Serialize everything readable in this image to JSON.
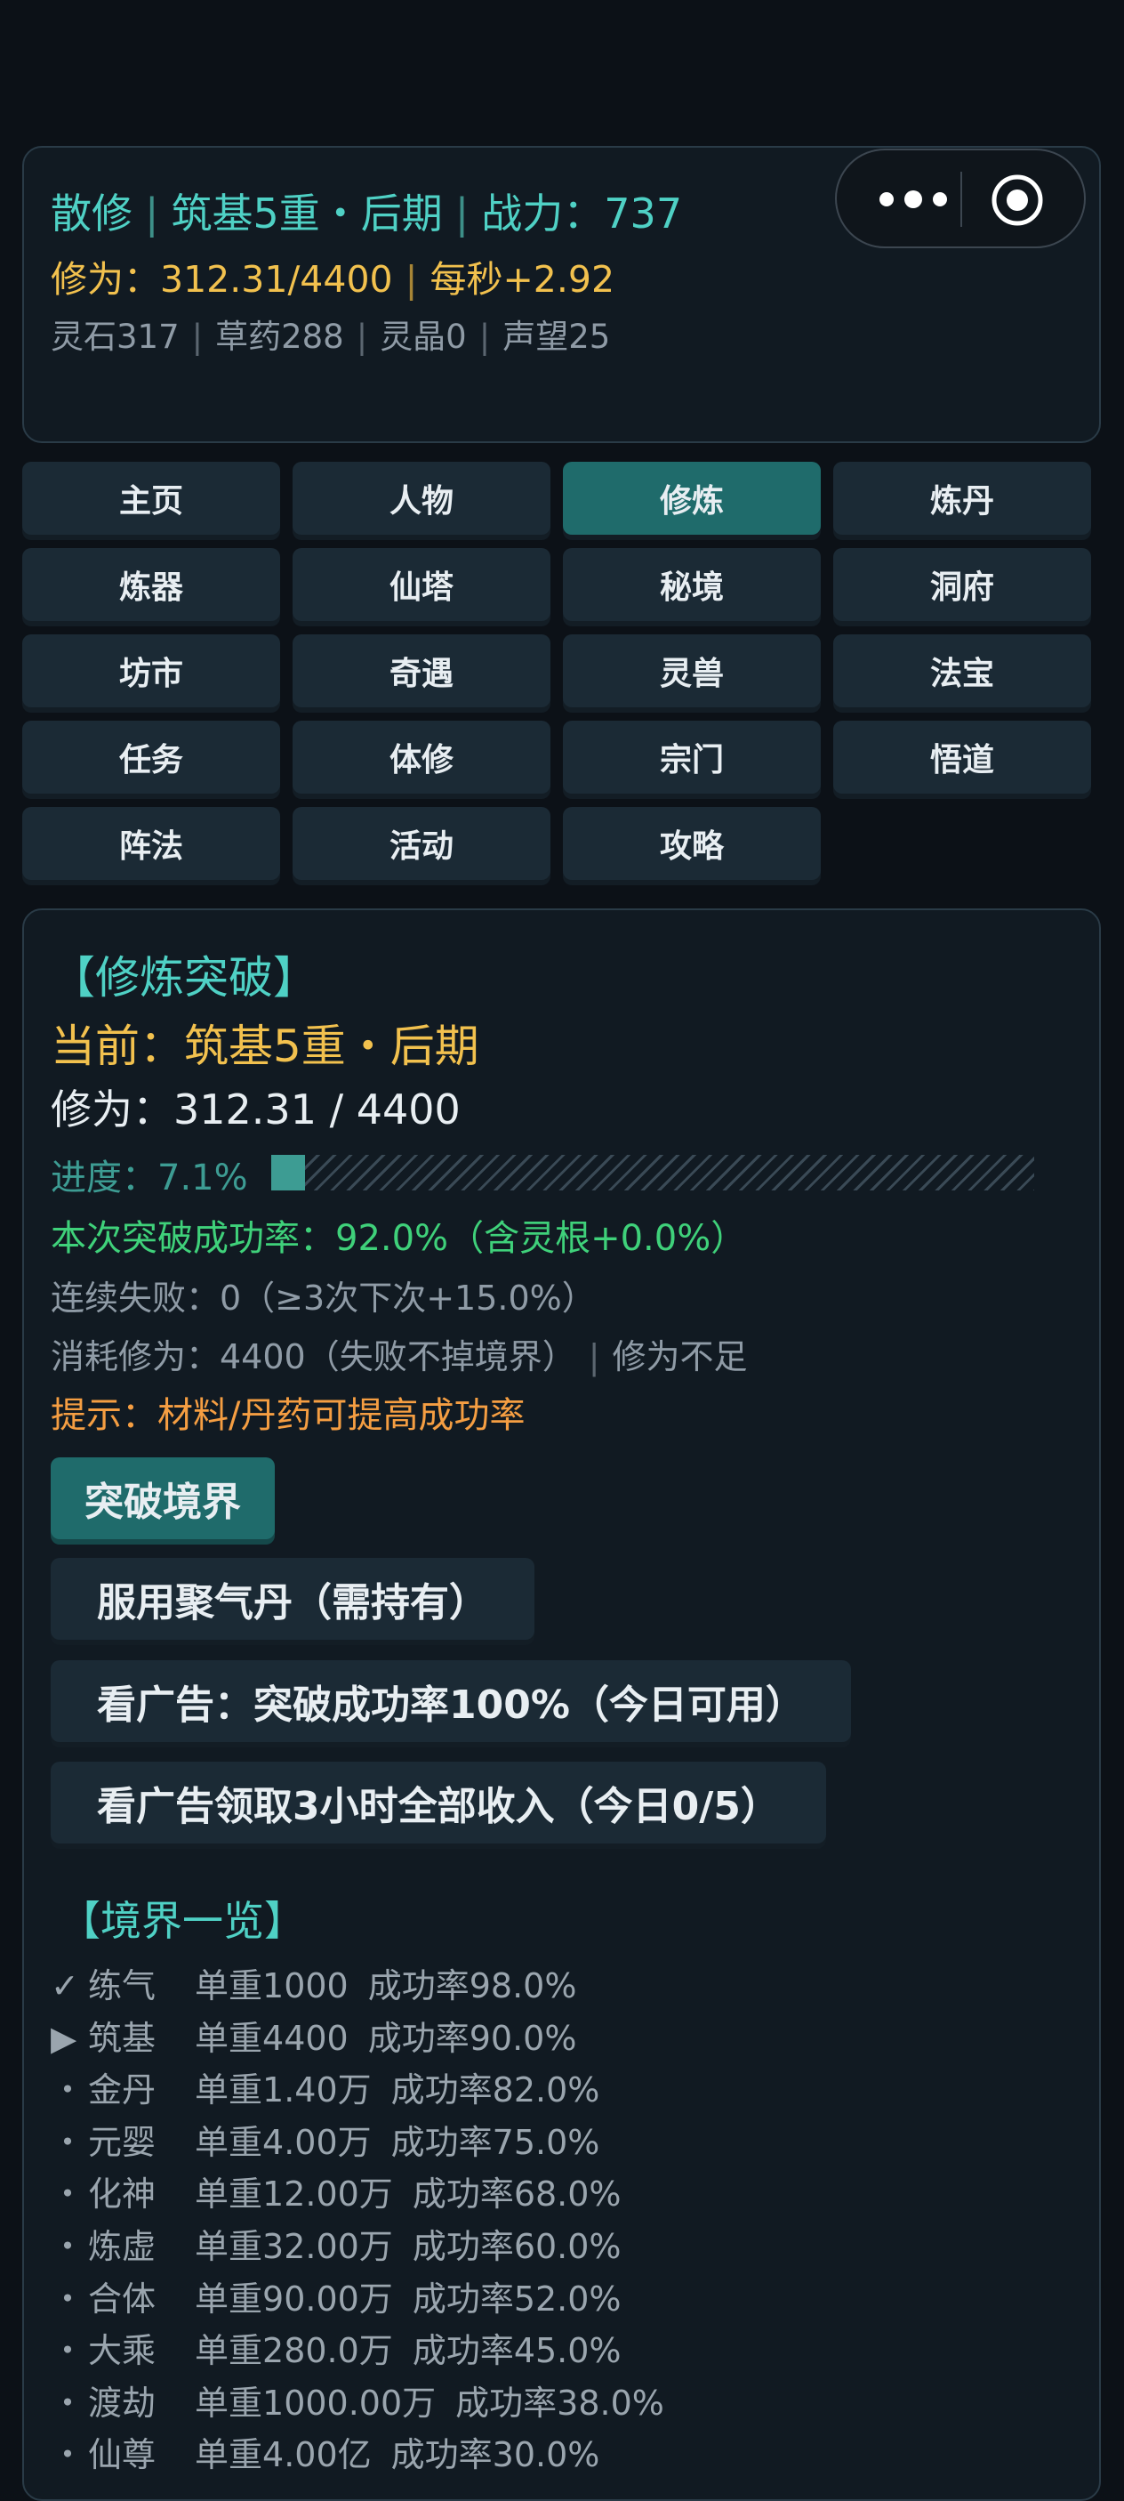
{
  "status": {
    "sect": "散修",
    "realm": "筑基5重・后期",
    "power": "战力：737",
    "cultivation": "修为：312.31/4400",
    "rate": "每秒+2.92",
    "resources": [
      "灵石317",
      "草药288",
      "灵晶0",
      "声望25"
    ]
  },
  "capsule": {
    "more_icon": "more-dots-icon",
    "close_icon": "target-icon"
  },
  "tabs": [
    {
      "label": "主页",
      "active": false
    },
    {
      "label": "人物",
      "active": false
    },
    {
      "label": "修炼",
      "active": true
    },
    {
      "label": "炼丹",
      "active": false
    },
    {
      "label": "炼器",
      "active": false
    },
    {
      "label": "仙塔",
      "active": false
    },
    {
      "label": "秘境",
      "active": false
    },
    {
      "label": "洞府",
      "active": false
    },
    {
      "label": "坊市",
      "active": false
    },
    {
      "label": "奇遇",
      "active": false
    },
    {
      "label": "灵兽",
      "active": false
    },
    {
      "label": "法宝",
      "active": false
    },
    {
      "label": "任务",
      "active": false
    },
    {
      "label": "体修",
      "active": false
    },
    {
      "label": "宗门",
      "active": false
    },
    {
      "label": "悟道",
      "active": false
    },
    {
      "label": "阵法",
      "active": false
    },
    {
      "label": "活动",
      "active": false
    },
    {
      "label": "攻略",
      "active": false
    }
  ],
  "breakthrough": {
    "title": "【修炼突破】",
    "current": "当前：筑基5重・后期",
    "cultivation": "修为：312.31 / 4400",
    "progress_label": "进度：7.1%",
    "progress": 0.071,
    "success_rate": "本次突破成功率：92.0%（含灵根+0.0%）",
    "fail_streak": "连续失败：0（≥3次下次+15.0%）",
    "cost": "消耗修为：4400（失败不掉境界）",
    "cost_status": "修为不足",
    "tip": "提示：材料/丹药可提高成功率"
  },
  "buttons": {
    "breakthrough": "突破境界",
    "pill": "服用聚气丹（需持有）",
    "ad_rate": "看广告：突破成功率100%（今日可用）",
    "ad_income": "看广告领取3小时全部收入（今日0/5）"
  },
  "realms": {
    "title": "【境界一览】",
    "items": [
      {
        "mark": "✓",
        "name": "练气",
        "cost": "单重1000",
        "rate": "成功率98.0%"
      },
      {
        "mark": "▶",
        "name": "筑基",
        "cost": "单重4400",
        "rate": "成功率90.0%"
      },
      {
        "mark": "・",
        "name": "金丹",
        "cost": "单重1.40万",
        "rate": "成功率82.0%"
      },
      {
        "mark": "・",
        "name": "元婴",
        "cost": "单重4.00万",
        "rate": "成功率75.0%"
      },
      {
        "mark": "・",
        "name": "化神",
        "cost": "单重12.00万",
        "rate": "成功率68.0%"
      },
      {
        "mark": "・",
        "name": "炼虚",
        "cost": "单重32.00万",
        "rate": "成功率60.0%"
      },
      {
        "mark": "・",
        "name": "合体",
        "cost": "单重90.00万",
        "rate": "成功率52.0%"
      },
      {
        "mark": "・",
        "name": "大乘",
        "cost": "单重280.0万",
        "rate": "成功率45.0%"
      },
      {
        "mark": "・",
        "name": "渡劫",
        "cost": "单重1000.00万",
        "rate": "成功率38.0%"
      },
      {
        "mark": "・",
        "name": "仙尊",
        "cost": "单重4.00亿",
        "rate": "成功率30.0%"
      }
    ]
  }
}
